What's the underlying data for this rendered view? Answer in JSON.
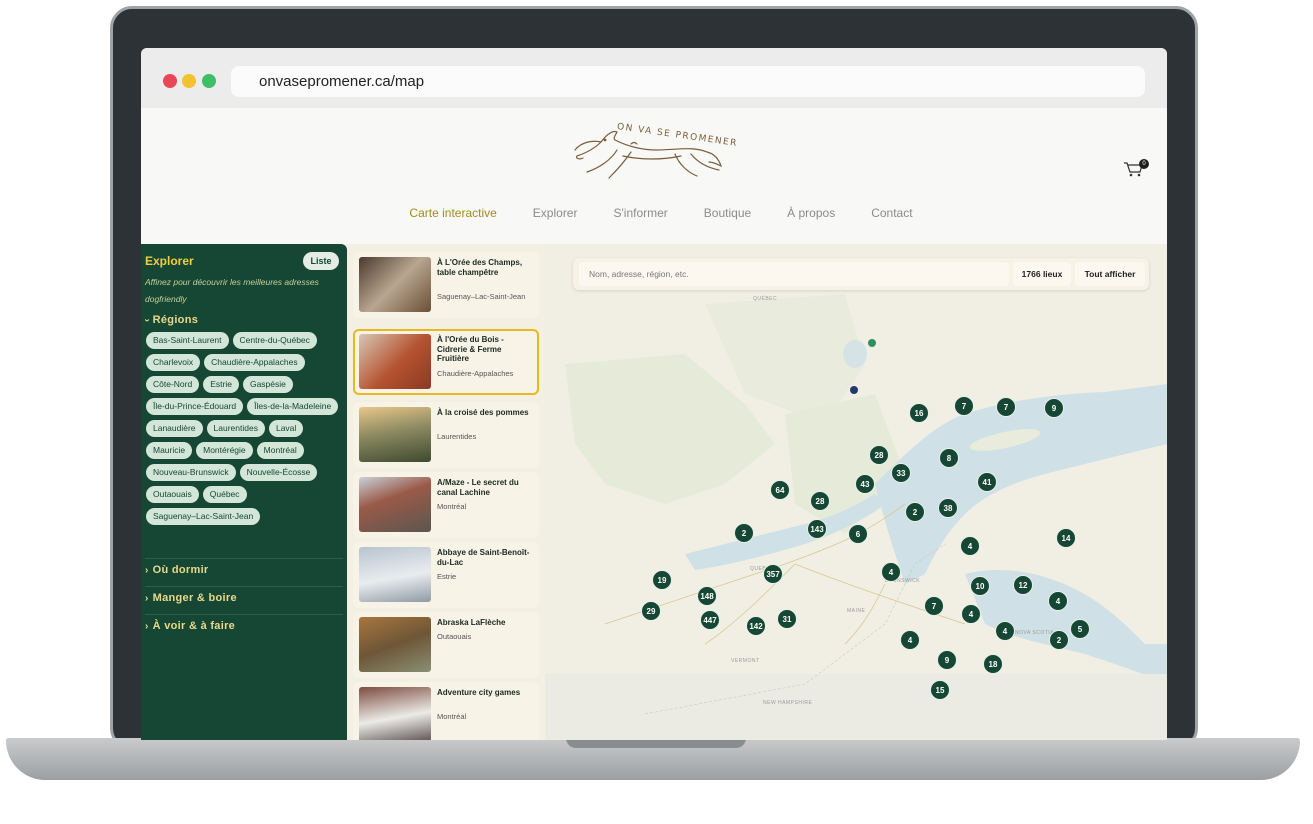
{
  "browser": {
    "url": "onvasepromener.ca/map"
  },
  "header": {
    "logo_text": "ON VA SE PROMENER",
    "cart_count": "0",
    "nav": [
      {
        "label": "Carte interactive",
        "active": true
      },
      {
        "label": "Explorer"
      },
      {
        "label": "S'informer"
      },
      {
        "label": "Boutique"
      },
      {
        "label": "À propos"
      },
      {
        "label": "Contact"
      }
    ]
  },
  "sidebar": {
    "title": "Explorer",
    "list_button": "Liste",
    "subtitle": "Affinez pour découvrir les meilleures adresses dogfriendly",
    "regions_label": "Régions",
    "regions": [
      "Bas-Saint-Laurent",
      "Centre-du-Québec",
      "Charlevoix",
      "Chaudière-Appalaches",
      "Côte-Nord",
      "Estrie",
      "Gaspésie",
      "Île-du-Prince-Édouard",
      "Îles-de-la-Madeleine",
      "Lanaudière",
      "Laurentides",
      "Laval",
      "Mauricie",
      "Montérégie",
      "Montréal",
      "Nouveau-Brunswick",
      "Nouvelle-Écosse",
      "Outaouais",
      "Québec",
      "Saguenay–Lac-Saint-Jean"
    ],
    "sections": [
      "Où dormir",
      "Manger & boire",
      "À voir & à faire"
    ]
  },
  "listing": [
    {
      "name": "À L'Orée des Champs, table champêtre",
      "region": "Saguenay–Lac-Saint-Jean",
      "thumb_color": "#7a5a3e"
    },
    {
      "name": "À l'Orée du Bois - Cidrerie & Ferme Fruitière",
      "region": "Chaudière-Appalaches",
      "thumb_color": "#b5522f",
      "selected": true
    },
    {
      "name": "À la croisé des pommes",
      "region": "Laurentides",
      "thumb_color": "#6d6a48"
    },
    {
      "name": "A/Maze - Le secret du canal Lachine",
      "region": "Montréal",
      "thumb_color": "#8b7262"
    },
    {
      "name": "Abbaye de Saint-Benoît-du-Lac",
      "region": "Estrie",
      "thumb_color": "#a9b2bd"
    },
    {
      "name": "Abraska LaFlèche",
      "region": "Outaouais",
      "thumb_color": "#6e5637"
    },
    {
      "name": "Adventure city games",
      "region": "Montréal",
      "thumb_color": "#7d4c40"
    }
  ],
  "map": {
    "search_placeholder": "Nom, adresse, région, etc.",
    "count_label": "1766 lieux",
    "show_all_label": "Tout afficher",
    "place_labels": [
      "QUÉBEC",
      "QUEBEC",
      "MAINE",
      "NEW BRUNSWICK",
      "NOVA SCOTIA",
      "VERMONT",
      "NEW HAMPSHIRE"
    ],
    "clusters": [
      "16",
      "7",
      "7",
      "9",
      "28",
      "8",
      "33",
      "43",
      "41",
      "64",
      "28",
      "2",
      "38",
      "143",
      "2",
      "6",
      "4",
      "14",
      "357",
      "19",
      "148",
      "4",
      "10",
      "12",
      "4",
      "29",
      "7",
      "4",
      "5",
      "447",
      "142",
      "31",
      "4",
      "2",
      "4",
      "9",
      "18",
      "15"
    ]
  }
}
